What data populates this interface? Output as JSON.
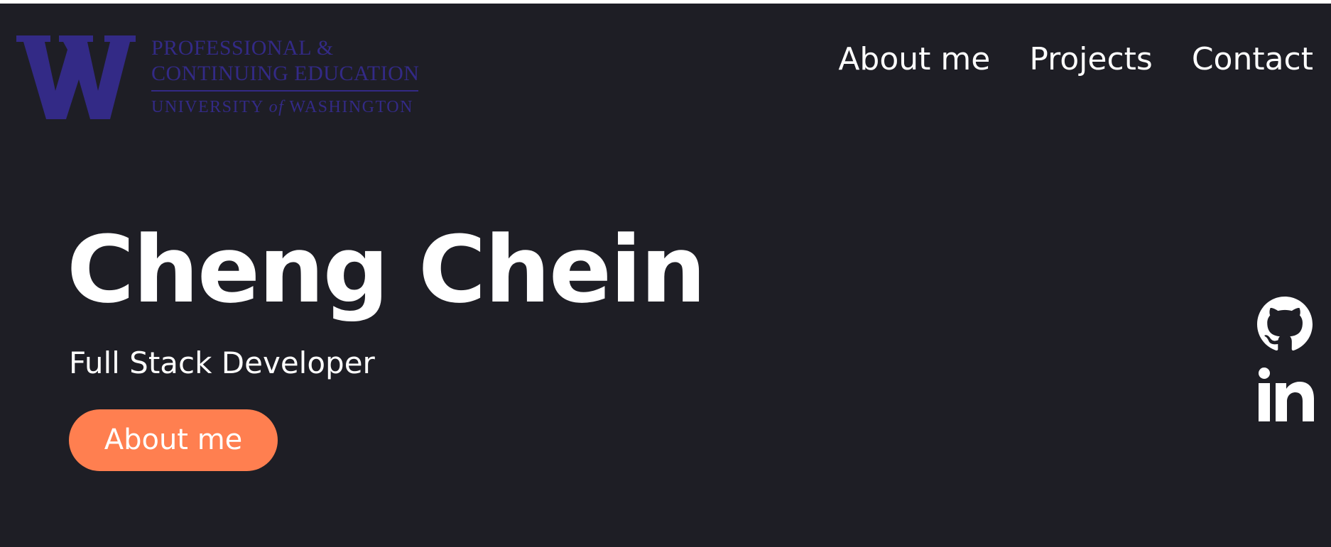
{
  "header": {
    "logo": {
      "line1": "PROFESSIONAL &",
      "line2": "CONTINUING EDUCATION",
      "line3_pre": "UNIVERSITY ",
      "line3_of": "of",
      "line3_post": " WASHINGTON",
      "mark_letter": "W",
      "color": "#332a86"
    },
    "nav": [
      {
        "label": "About me"
      },
      {
        "label": "Projects"
      },
      {
        "label": "Contact"
      }
    ]
  },
  "hero": {
    "name": "Cheng Chein",
    "role": "Full Stack Developer",
    "button_label": "About me",
    "button_color": "#ff7f50"
  },
  "social": [
    {
      "icon": "github-icon"
    },
    {
      "icon": "linkedin-icon"
    }
  ],
  "colors": {
    "background": "#1e1e25",
    "text": "#ffffff"
  }
}
